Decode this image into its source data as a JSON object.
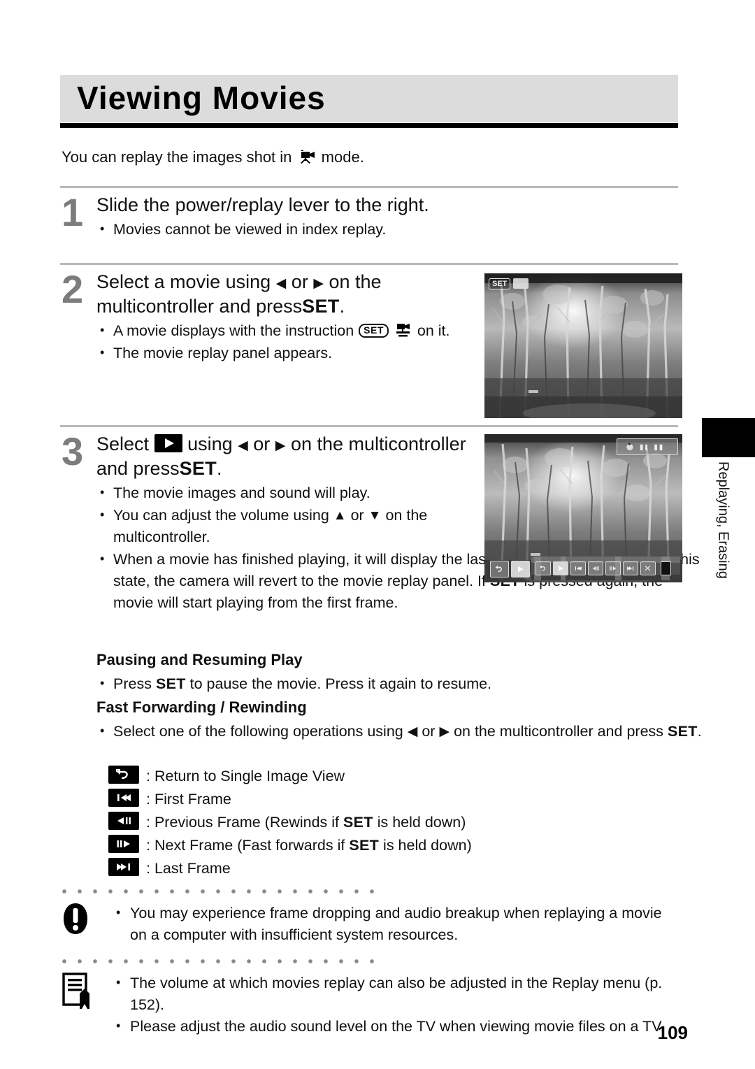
{
  "header": {
    "title": "Viewing Movies",
    "bg_color": "#dcdcdc",
    "rule_color": "#000000"
  },
  "intro": {
    "before_icon": "You can replay the images shot in",
    "icon": "movie-camera-icon",
    "after_icon": "mode."
  },
  "steps": [
    {
      "number": "1",
      "heading": "Slide the power/replay lever to the right.",
      "bullets": [
        "Movies cannot be viewed in index replay."
      ]
    },
    {
      "number": "2",
      "heading_part1": "Select a movie using",
      "heading_arrow_left": "◀",
      "heading_or": "or",
      "heading_arrow_right": "▶",
      "heading_part2": "on the multicontroller and press",
      "heading_set": "SET",
      "heading_end": ".",
      "bullets": [
        {
          "part1": "A movie displays with the instruction",
          "icon_set": "SET",
          "icon_movie": "movie-instruction-icon",
          "part2": "on it."
        },
        {
          "text": "The movie replay panel appears."
        }
      ]
    },
    {
      "number": "3",
      "heading_part1": "Select",
      "heading_icon": "play-icon",
      "heading_using": "using",
      "heading_arrow_left": "◀",
      "heading_or": "or",
      "heading_arrow_right": "▶",
      "heading_part2": "on the multicontroller and press",
      "heading_set": "SET",
      "heading_end": ".",
      "bullets": [
        {
          "text": "The movie images and sound will play."
        },
        {
          "part1": "You can adjust the volume using",
          "arrow_up": "▲",
          "or": "or",
          "arrow_down": "▼",
          "part2": "on the multicontroller."
        },
        {
          "part1": "When a movie has finished playing, it will display the last frame. If",
          "set1": "SET",
          "part2": "is pressed in this state, the camera will revert to the movie replay panel.  If",
          "set2": "SET",
          "part3": "is pressed again, the movie will start playing from the first frame."
        }
      ]
    }
  ],
  "pausing": {
    "heading": "Pausing and Resuming Play",
    "bullet_part1": "Press",
    "bullet_set": "SET",
    "bullet_part2": "to pause the movie. Press it again to resume."
  },
  "fastforward": {
    "heading": "Fast Forwarding / Rewinding",
    "bullet_part1": "Select one of the following operations using",
    "arrow_left": "◀",
    "or": "or",
    "arrow_right": "▶",
    "bullet_part2": "on the multicontroller and press",
    "bullet_set": "SET",
    "bullet_end": "."
  },
  "operations": [
    {
      "icon": "return-icon",
      "separator": ":",
      "label": "Return to Single Image View"
    },
    {
      "icon": "first-frame-icon",
      "separator": ":",
      "label": "First Frame"
    },
    {
      "icon": "previous-frame-icon",
      "separator": ":",
      "label_part1": "Previous Frame (Rewinds if",
      "set": "SET",
      "label_part2": "is held down)"
    },
    {
      "icon": "next-frame-icon",
      "separator": ":",
      "label_part1": "Next Frame (Fast forwards if",
      "set": "SET",
      "label_part2": "is held down)"
    },
    {
      "icon": "last-frame-icon",
      "separator": ":",
      "label": "Last Frame"
    }
  ],
  "notes": {
    "warning": {
      "icon": "warning-exclamation-icon",
      "line1": "You may experience frame dropping and audio breakup when replaying a movie",
      "line2": "on a computer with insufficient system resources."
    },
    "info": {
      "icon": "note-pencil-icon",
      "items": [
        "The volume at which movies replay can also be adjusted in the Replay menu (p. 152).",
        "Please adjust the audio sound level on the TV when viewing movie files on a TV."
      ]
    }
  },
  "photos": {
    "photo1": {
      "name": "forest-movie-thumbnail",
      "badge_set": "SET",
      "badge_icon": "movie-play-badge-icon"
    },
    "photo2": {
      "name": "forest-movie-playback",
      "time_badge": "movie-time-badge",
      "panel_buttons": [
        "return-icon",
        "play-icon",
        "first-frame-icon",
        "previous-frame-icon",
        "next-frame-icon",
        "last-frame-icon",
        "edit-scissors-icon"
      ],
      "volume_indicator": "volume-indicator"
    },
    "photo3": {
      "name": "movie-replay-panel-closeup"
    }
  },
  "side_tab": {
    "label": "Replaying, Erasing",
    "tab_color": "#000000"
  },
  "page_number": "109"
}
